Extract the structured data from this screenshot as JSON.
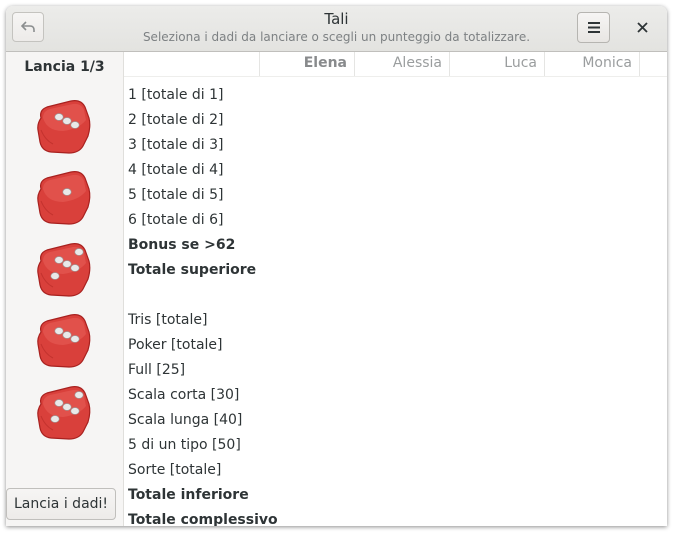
{
  "window": {
    "title": "Tali",
    "subtitle": "Seleziona i dadi da lanciare o scegli un punteggio da totalizzare."
  },
  "headerbar": {
    "back_icon": "undo-icon",
    "menu_icon": "hamburger-menu-icon",
    "close_icon": "close-icon"
  },
  "sidebar": {
    "roll_label": "Lancia 1/3",
    "dice": [
      {
        "value": 3,
        "icon": "die-three-icon"
      },
      {
        "value": 1,
        "icon": "die-one-icon"
      },
      {
        "value": 5,
        "icon": "die-five-icon"
      },
      {
        "value": 3,
        "icon": "die-three-icon"
      },
      {
        "value": 5,
        "icon": "die-five-icon"
      }
    ],
    "roll_button": "Lancia i dadi!"
  },
  "scoreboard": {
    "players": [
      "Elena",
      "Alessia",
      "Luca",
      "Monica"
    ],
    "active_player": "Elena",
    "rows": [
      {
        "label": "1 [totale di 1]",
        "bold": false
      },
      {
        "label": "2 [totale di 2]",
        "bold": false
      },
      {
        "label": "3 [totale di 3]",
        "bold": false
      },
      {
        "label": "4 [totale di 4]",
        "bold": false
      },
      {
        "label": "5 [totale di 5]",
        "bold": false
      },
      {
        "label": "6 [totale di 6]",
        "bold": false
      },
      {
        "label": "Bonus se >62",
        "bold": true
      },
      {
        "label": "Totale superiore",
        "bold": true
      },
      {
        "label": "",
        "bold": false
      },
      {
        "label": "Tris [totale]",
        "bold": false
      },
      {
        "label": "Poker [totale]",
        "bold": false
      },
      {
        "label": "Full [25]",
        "bold": false
      },
      {
        "label": "Scala corta [30]",
        "bold": false
      },
      {
        "label": "Scala lunga [40]",
        "bold": false
      },
      {
        "label": "5 di un tipo [50]",
        "bold": false
      },
      {
        "label": "Sorte [totale]",
        "bold": false
      },
      {
        "label": "Totale inferiore",
        "bold": true
      },
      {
        "label": "Totale complessivo",
        "bold": true
      }
    ]
  },
  "colors": {
    "die_red": "#d9403b",
    "die_dark": "#a8211f",
    "pip": "#e9e9e9"
  }
}
